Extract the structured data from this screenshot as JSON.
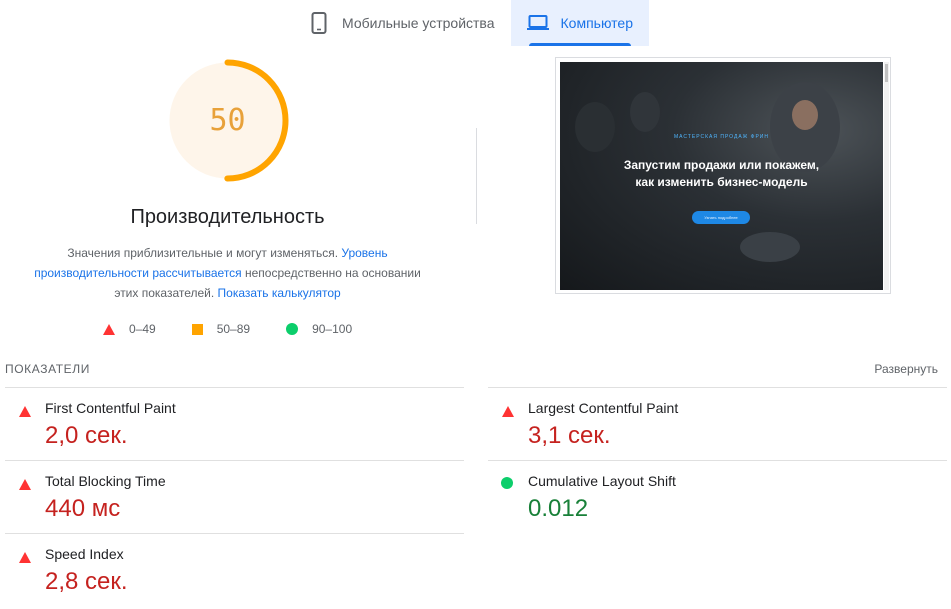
{
  "tabs": [
    {
      "label": "Мобильные устройства",
      "icon": "smartphone-icon",
      "active": false
    },
    {
      "label": "Компьютер",
      "icon": "laptop-icon",
      "active": true
    }
  ],
  "score": {
    "value": "50",
    "fraction": 0.5,
    "color": "#ffa400",
    "title": "Производительность"
  },
  "description": {
    "text1": "Значения приблизительные и могут изменяться. ",
    "link1": "Уровень производительности рассчитывается",
    "text2": " непосредственно на основании этих показателей. ",
    "link2": "Показать калькулятор"
  },
  "legend": [
    {
      "range": "0–49",
      "shape": "triangle",
      "color": "#ff3333"
    },
    {
      "range": "50–89",
      "shape": "square",
      "color": "#ffa400"
    },
    {
      "range": "90–100",
      "shape": "circle",
      "color": "#0cce6b"
    }
  ],
  "screenshot": {
    "brand": "МАСТЕРСКАЯ ПРОДАЖ ФРИН",
    "headline_line1": "Запустим продажи или покажем,",
    "headline_line2": "как изменить бизнес-модель",
    "button": "Узнать подробнее"
  },
  "metrics_section": {
    "header": "ПОКАЗАТЕЛИ",
    "expand_label": "Развернуть"
  },
  "metrics": {
    "fcp": {
      "label": "First Contentful Paint",
      "value": "2,0 сек.",
      "status": "bad"
    },
    "lcp": {
      "label": "Largest Contentful Paint",
      "value": "3,1 сек.",
      "status": "bad"
    },
    "tbt": {
      "label": "Total Blocking Time",
      "value": "440 мс",
      "status": "bad"
    },
    "cls": {
      "label": "Cumulative Layout Shift",
      "value": "0.012",
      "status": "good"
    },
    "si": {
      "label": "Speed Index",
      "value": "2,8 сек.",
      "status": "bad"
    }
  },
  "colors": {
    "accent": "#1a73e8",
    "bad": "#c5221f",
    "good": "#188038",
    "average": "#ffa400"
  }
}
